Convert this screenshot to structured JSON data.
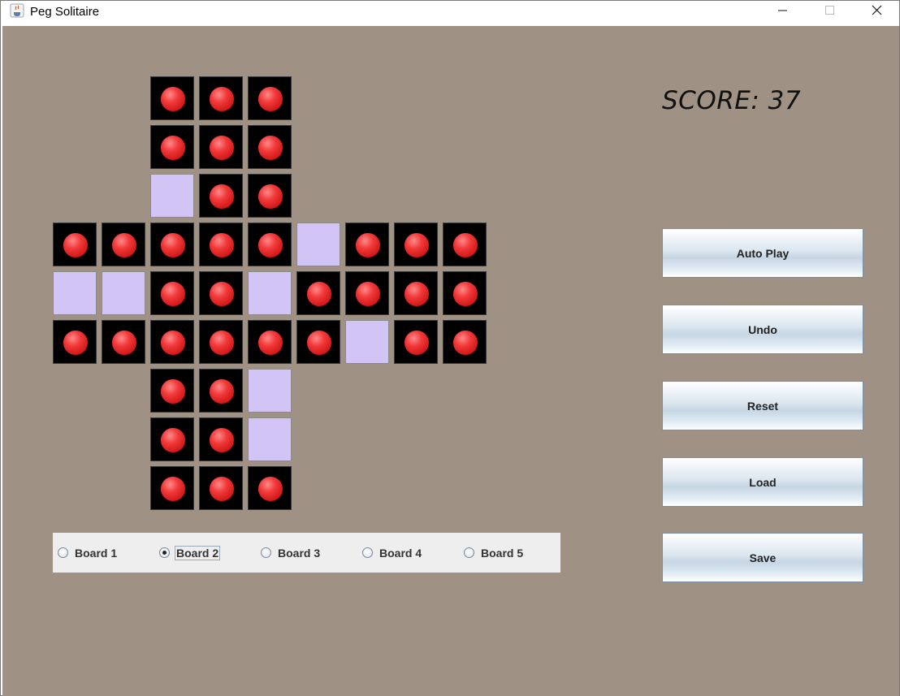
{
  "window": {
    "title": "Peg Solitaire",
    "controls": {
      "minimize_icon": "minimize-icon",
      "maximize_icon": "maximize-icon",
      "close_icon": "close-icon"
    }
  },
  "score": {
    "text": "SCORE: 37"
  },
  "board": {
    "rows": [
      "--PPP----",
      "--PPP----",
      "--EPP----",
      "PPPPPEPPP",
      "EEPPEPPPP",
      "PPPPPPEPP",
      "--PPE----",
      "--PPE----",
      "--PPP----"
    ],
    "legend": {
      "P": "peg",
      "E": "empty-hole",
      "-": "no-cell"
    },
    "colors": {
      "peg": "#e02828",
      "peg_cell_bg": "#000000",
      "empty_cell_bg": "#d2c4f4",
      "background": "#9f9284"
    }
  },
  "buttons": [
    {
      "id": "auto-play",
      "label": "Auto Play"
    },
    {
      "id": "undo",
      "label": "Undo"
    },
    {
      "id": "reset",
      "label": "Reset"
    },
    {
      "id": "load",
      "label": "Load"
    },
    {
      "id": "save",
      "label": "Save"
    }
  ],
  "board_options": {
    "selected": "Board 2",
    "options": [
      "Board 1",
      "Board 2",
      "Board 3",
      "Board 4",
      "Board 5"
    ]
  }
}
